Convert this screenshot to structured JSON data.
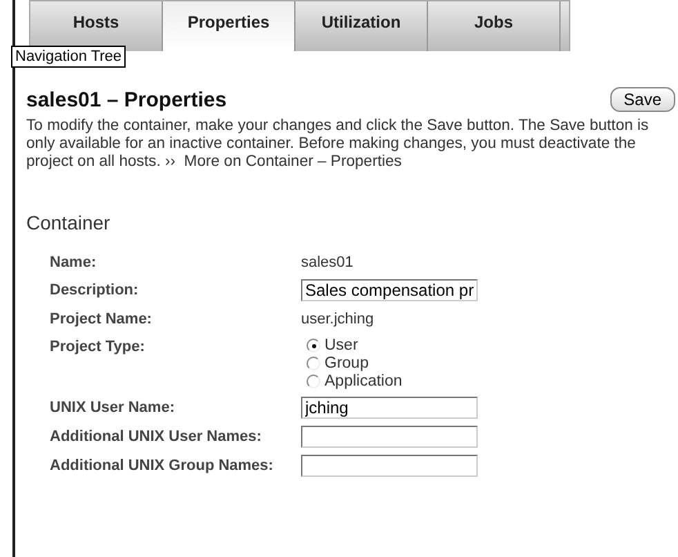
{
  "tabs": [
    {
      "label": "Hosts",
      "selected": false
    },
    {
      "label": "Properties",
      "selected": true
    },
    {
      "label": "Utilization",
      "selected": false
    },
    {
      "label": "Jobs",
      "selected": false
    }
  ],
  "tooltip": "Navigation Tree",
  "page": {
    "title": "sales01 – Properties",
    "save_button": "Save",
    "intro": "To modify the container, make your changes and click the Save button. The Save button is only available for an inactive container. Before making changes, you must deactivate the project on all hosts.",
    "more_marker": "››",
    "more_link": "More on Container – Properties"
  },
  "section": {
    "title": "Container",
    "fields": [
      {
        "kind": "text",
        "label": "Name:",
        "value": "sales01"
      },
      {
        "kind": "input",
        "label": "Description:",
        "value": "Sales compensation pr"
      },
      {
        "kind": "text",
        "label": "Project Name:",
        "value": "user.jching"
      },
      {
        "kind": "radio",
        "label": "Project Type:",
        "options": [
          {
            "label": "User",
            "selected": true
          },
          {
            "label": "Group",
            "selected": false
          },
          {
            "label": "Application",
            "selected": false
          }
        ]
      },
      {
        "kind": "input",
        "label": "UNIX User Name:",
        "value": "jching"
      },
      {
        "kind": "input",
        "label": "Additional UNIX User Names:"
      },
      {
        "kind": "input",
        "label": "Additional UNIX Group Names:"
      }
    ]
  }
}
